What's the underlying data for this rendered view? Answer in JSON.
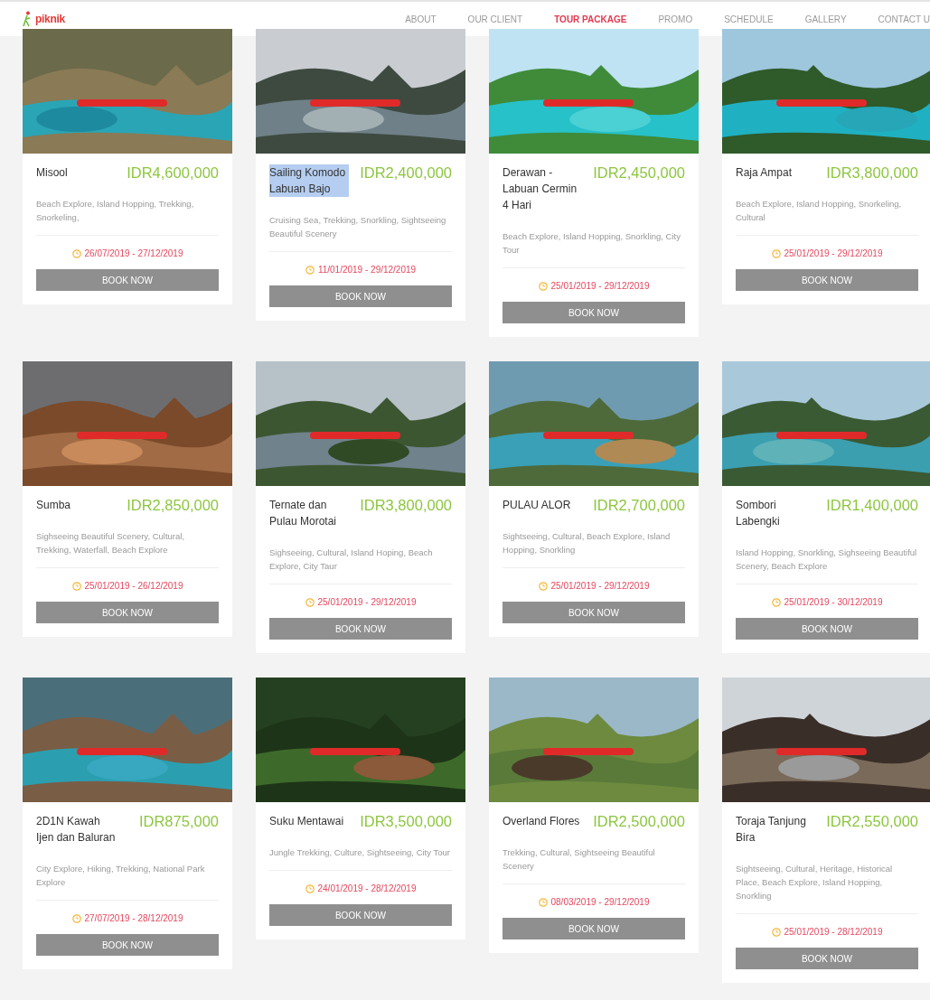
{
  "header": {
    "logo": "piknik",
    "nav": [
      {
        "label": "ABOUT",
        "selected": false
      },
      {
        "label": "OUR CLIENT",
        "selected": false
      },
      {
        "label": "TOUR PACKAGE",
        "selected": true
      },
      {
        "label": "PROMO",
        "selected": false
      },
      {
        "label": "SCHEDULE",
        "selected": false
      },
      {
        "label": "GALLERY",
        "selected": false
      },
      {
        "label": "CONTACT U",
        "selected": false
      }
    ]
  },
  "packages": [
    {
      "title": "Misool",
      "highlighted": false,
      "price": "IDR4,600,000",
      "activities": "Beach Explore, Island Hopping, Trekking, Snorkeling,",
      "dates": "26/07/2019 - 27/12/2019",
      "button": "BOOK NOW"
    },
    {
      "title": "Sailing Komodo Labuan Bajo",
      "highlighted": true,
      "price": "IDR2,400,000",
      "activities": "Cruising Sea, Trekking, Snorkling, Sightseeing Beautiful Scenery",
      "dates": "11/01/2019 - 29/12/2019",
      "button": "BOOK NOW"
    },
    {
      "title": "Derawan - Labuan Cermin 4 Hari",
      "highlighted": false,
      "price": "IDR2,450,000",
      "activities": "Beach Explore, Island Hopping, Snorkling, City Tour",
      "dates": "25/01/2019 - 29/12/2019",
      "button": "BOOK NOW"
    },
    {
      "title": "Raja Ampat",
      "highlighted": false,
      "price": "IDR3,800,000",
      "activities": "Beach Explore, Island Hopping, Snorkeling, Cultural",
      "dates": "25/01/2019 - 29/12/2019",
      "button": "BOOK NOW"
    },
    {
      "title": "Sumba",
      "highlighted": false,
      "price": "IDR2,850,000",
      "activities": "Sighseeing Beautiful Scenery, Cultural, Trekking, Waterfall, Beach Explore",
      "dates": "25/01/2019 - 26/12/2019",
      "button": "BOOK NOW"
    },
    {
      "title": "Ternate dan Pulau Morotai",
      "highlighted": false,
      "price": "IDR3,800,000",
      "activities": "Sighseeing, Cultural, Island Hoping, Beach Explore, City Taur",
      "dates": "25/01/2019 - 29/12/2019",
      "button": "BOOK NOW"
    },
    {
      "title": "PULAU ALOR",
      "highlighted": false,
      "price": "IDR2,700,000",
      "activities": "Sightseeing, Cultural, Beach Explore, Island Hopping, Snorkling",
      "dates": "25/01/2019 - 29/12/2019",
      "button": "BOOK NOW"
    },
    {
      "title": "Sombori Labengki",
      "highlighted": false,
      "price": "IDR1,400,000",
      "activities": "Island Hopping, Snorkling, Sighseeing Beautiful Scenery, Beach Explore",
      "dates": "25/01/2019 - 30/12/2019",
      "button": "BOOK NOW"
    },
    {
      "title": "2D1N Kawah Ijen dan Baluran",
      "highlighted": false,
      "price": "IDR875,000",
      "activities": "City Explore, Hiking, Trekking, National Park Explore",
      "dates": "27/07/2019 - 28/12/2019",
      "button": "BOOK NOW"
    },
    {
      "title": "Suku Mentawai",
      "highlighted": false,
      "price": "IDR3,500,000",
      "activities": "Jungle Trekking, Culture, Sightseeing, City Tour",
      "dates": "24/01/2019 - 28/12/2019",
      "button": "BOOK NOW"
    },
    {
      "title": "Overland Flores",
      "highlighted": false,
      "price": "IDR2,500,000",
      "activities": "Trekking, Cultural, Sightseeing Beautiful Scenery",
      "dates": "08/03/2019 - 29/12/2019",
      "button": "BOOK NOW"
    },
    {
      "title": "Toraja Tanjung Bira",
      "highlighted": false,
      "price": "IDR2,550,000",
      "activities": "Sightseeing, Cultural, Heritage, Historical Place, Beach Explore, Island Hopping, Snorkling",
      "dates": "25/01/2019 - 28/12/2019",
      "button": "BOOK NOW"
    }
  ]
}
